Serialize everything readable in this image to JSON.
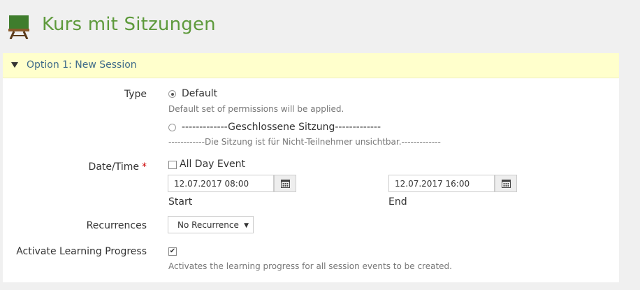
{
  "page": {
    "title": "Kurs mit Sitzungen",
    "icon": "course-board-icon",
    "title_color": "#5e9a3c"
  },
  "panel": {
    "title": "Option 1: New Session",
    "header_color": "#ffffcc"
  },
  "form": {
    "type": {
      "label": "Type",
      "options": [
        {
          "label": "Default",
          "description": "Default set of permissions will be applied.",
          "selected": true
        },
        {
          "label": "-------------Geschlossene Sitzung-------------",
          "description": "------------Die Sitzung ist für Nicht-Teilnehmer unsichtbar.-------------",
          "selected": false
        }
      ]
    },
    "datetime": {
      "label": "Date/Time",
      "required_marker": "*",
      "all_day_label": "All Day Event",
      "all_day_checked": false,
      "start_value": "12.07.2017 08:00",
      "start_label": "Start",
      "end_value": "12.07.2017 16:00",
      "end_label": "End"
    },
    "recurrences": {
      "label": "Recurrences",
      "selected": "No Recurrence"
    },
    "learning_progress": {
      "label": "Activate Learning Progress",
      "checked": true,
      "check_mark": "✔",
      "description": "Activates the learning progress for all session events to be created."
    }
  }
}
